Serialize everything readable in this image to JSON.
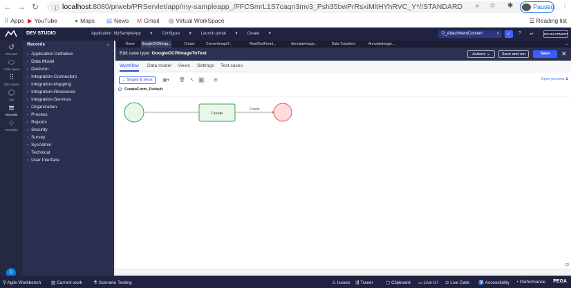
{
  "browser": {
    "url_host": "localhost",
    "url_rest": ":8080/prweb/PRServlet/app/my-sampleapp_/FFCSmrL1S7caqn3mv3_Psh35bwPrRsxiMltHYhRVC_Y*/!STANDARD",
    "profile_label": "Paused",
    "bookmarks": [
      "Apps",
      "YouTube",
      "Maps",
      "News",
      "Gmail",
      "Virtual WorkSpace"
    ],
    "reading_list": "Reading list"
  },
  "topbar": {
    "studio": "DEV STUDIO",
    "application": "Application: MySampleApp",
    "configure": "Configure",
    "launch_portal": "Launch portal",
    "create": "Create",
    "search_value": "D_AttachmentContent",
    "mode": "DEVELOPMENT"
  },
  "leftnav": {
    "recents": "Recents",
    "case_types": "Case types",
    "data_types": "Data types",
    "app": "App",
    "records": "Records",
    "favorites": "Favorites",
    "user_initial": "D"
  },
  "records": {
    "header": "Records",
    "items": [
      "Application Definition",
      "Data Model",
      "Decision",
      "Integration-Connectors",
      "Integration-Mapping",
      "Integration-Resources",
      "Integration-Services",
      "Organization",
      "Process",
      "Reports",
      "Security",
      "Survey",
      "SysAdmin",
      "Technical",
      "User Interface"
    ]
  },
  "tabs": [
    "Home",
    "GoogleOCRImag...",
    "Create",
    "ConvertImageT...",
    "ReadTextFromI...",
    "AnnotateImage...",
    "Data Transform",
    "AnnotateImage..."
  ],
  "case": {
    "title_prefix": "Edit case type:",
    "title_name": "GoogleOCRImageToText",
    "actions": "Actions",
    "save_and_run": "Save and run",
    "save": "Save"
  },
  "subtabs": [
    "Workflow",
    "Data model",
    "Views",
    "Settings",
    "Test cases"
  ],
  "toolbar": {
    "stages_steps": "Stages & steps",
    "open_process": "Open process"
  },
  "flow": {
    "name": "CreateForm_Default",
    "assignment_label": "Create",
    "connector_label": "Create"
  },
  "statusbar": {
    "left": [
      "Agile Workbench",
      "Current work",
      "Scenario Testing"
    ],
    "right": [
      "Issues",
      "Tracer",
      "Clipboard",
      "Live UI",
      "Live Data",
      "Accessibility",
      "Performance"
    ],
    "brand": "PEGA"
  },
  "colors": {
    "topbar": "#1f2340",
    "accent": "#3c5cff",
    "start_node": "#e8f7ea",
    "end_node": "#ffdcdc"
  }
}
